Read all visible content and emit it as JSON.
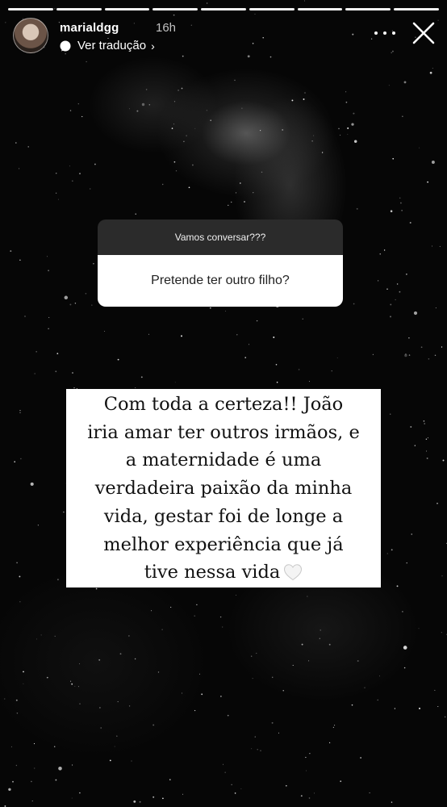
{
  "story": {
    "segments_total": 9,
    "segments_viewed": 9
  },
  "header": {
    "username": "marialdgg",
    "time": "16h",
    "translate_label": "Ver tradução",
    "translate_chevron": "›",
    "icons": {
      "avatar": "profile-avatar",
      "translate": "speech-bubble-icon",
      "more": "more-dots-icon",
      "close": "close-icon"
    }
  },
  "question_sticker": {
    "title": "Vamos conversar???",
    "question": "Pretende ter outro filho?"
  },
  "answer": {
    "lines": [
      "Com toda a certeza!! João",
      "iria amar ter outros irmãos, e",
      "a maternidade é uma",
      "verdadeira paixão da minha",
      "vida, gestar foi de longe a",
      "melhor experiência que já",
      "tive nessa vida"
    ],
    "emoji": "white-heart-icon"
  },
  "colors": {
    "background": "#060606",
    "sticker_header": "#2b2b2b",
    "sticker_body": "#ffffff",
    "text_white": "#ffffff"
  }
}
